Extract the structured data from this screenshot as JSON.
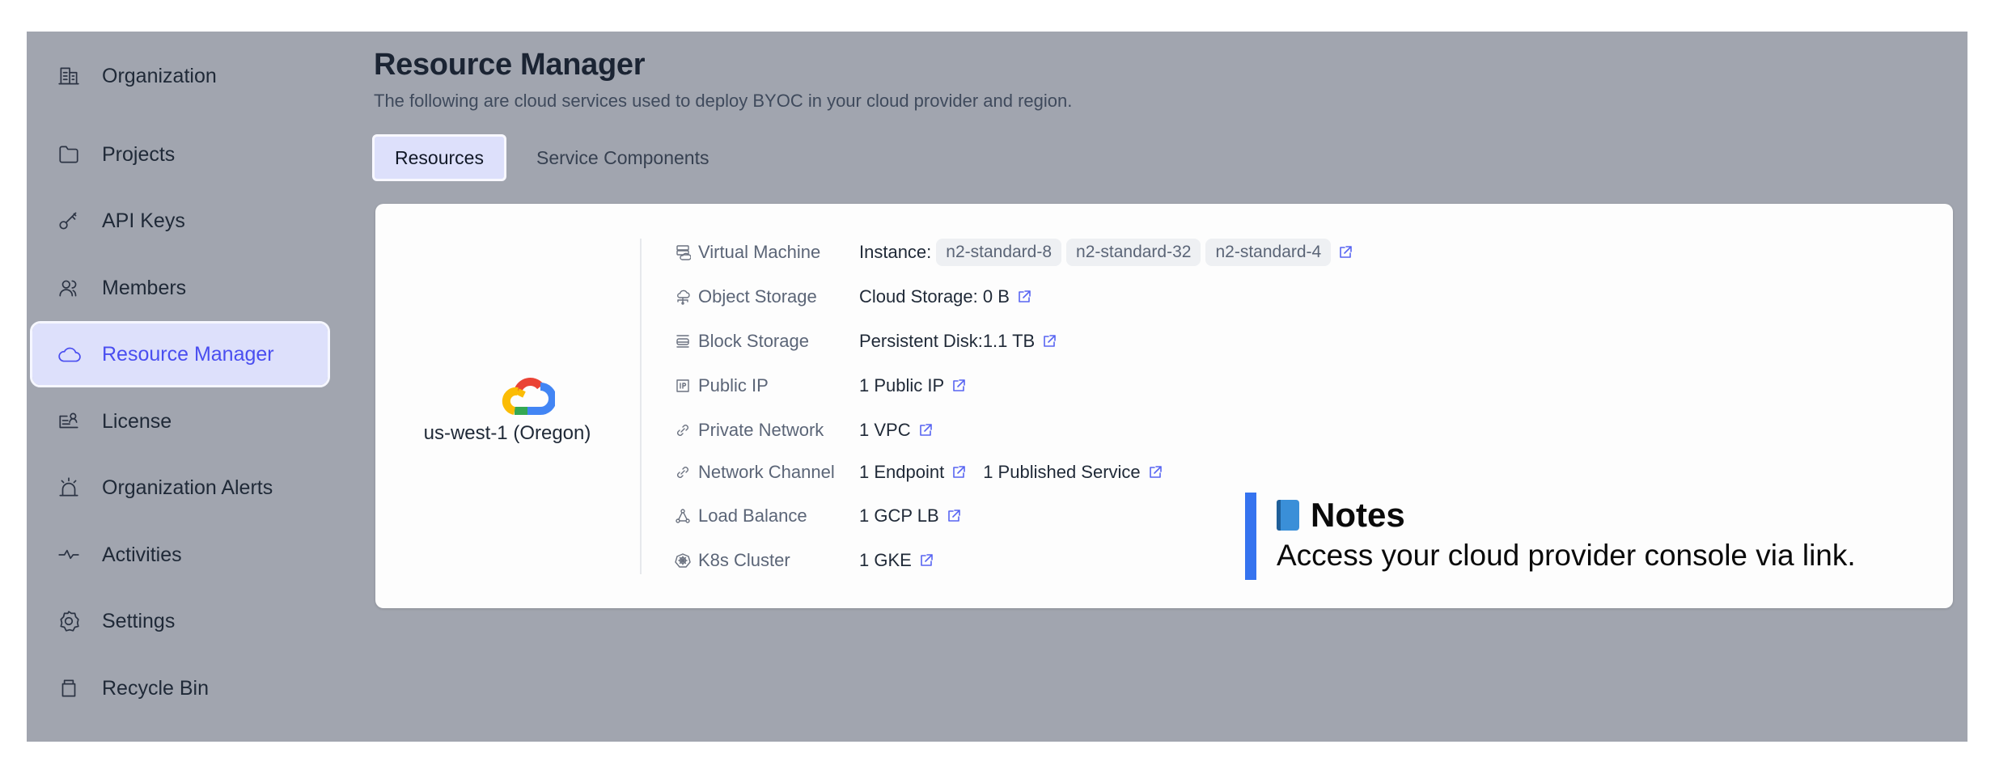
{
  "sidebar": {
    "items": [
      {
        "label": "Organization",
        "icon": "building-icon",
        "active": false
      },
      {
        "label": "Projects",
        "icon": "folder-icon",
        "active": false
      },
      {
        "label": "API Keys",
        "icon": "key-icon",
        "active": false
      },
      {
        "label": "Members",
        "icon": "users-icon",
        "active": false
      },
      {
        "label": "Resource Manager",
        "icon": "cloud-icon",
        "active": true
      },
      {
        "label": "License",
        "icon": "license-icon",
        "active": false
      },
      {
        "label": "Organization Alerts",
        "icon": "alarm-icon",
        "active": false
      },
      {
        "label": "Activities",
        "icon": "activity-icon",
        "active": false
      },
      {
        "label": "Settings",
        "icon": "gear-icon",
        "active": false
      },
      {
        "label": "Recycle Bin",
        "icon": "trash-icon",
        "active": false
      }
    ]
  },
  "header": {
    "title": "Resource Manager",
    "subtitle": "The following are cloud services used to deploy BYOC in your cloud provider and region."
  },
  "tabs": [
    {
      "label": "Resources",
      "active": true
    },
    {
      "label": "Service Components",
      "active": false
    }
  ],
  "region": {
    "provider": "Google Cloud",
    "name": "us-west-1 (Oregon)"
  },
  "resources": [
    {
      "label": "Virtual Machine",
      "icon": "server-cloud-icon",
      "prefix": "Instance:",
      "chips": [
        "n2-standard-8",
        "n2-standard-32",
        "n2-standard-4"
      ],
      "values": []
    },
    {
      "label": "Object Storage",
      "icon": "cloud-network-icon",
      "values": [
        "Cloud Storage: 0 B"
      ]
    },
    {
      "label": "Block Storage",
      "icon": "disk-icon",
      "values": [
        "Persistent Disk:1.1 TB"
      ]
    },
    {
      "label": "Public IP",
      "icon": "ip-icon",
      "values": [
        "1 Public IP"
      ]
    },
    {
      "label": "Private Network",
      "icon": "link-icon",
      "values": [
        "1 VPC"
      ]
    },
    {
      "label": "Network Channel",
      "icon": "link-icon",
      "values": [
        "1 Endpoint",
        "1 Published Service"
      ]
    },
    {
      "label": "Load Balance",
      "icon": "load-balance-icon",
      "values": [
        "1 GCP LB"
      ]
    },
    {
      "label": "K8s Cluster",
      "icon": "kubernetes-icon",
      "values": [
        "1 GKE"
      ]
    }
  ],
  "notes": {
    "icon": "blue-book-icon",
    "title": "Notes",
    "text": "Access your cloud provider console via link."
  },
  "colors": {
    "accent": "#4a4ef0",
    "active_bg": "#dde0fb",
    "overlay": "#a1a5af",
    "notes_bar": "#3573ef",
    "link": "#5865f2"
  }
}
